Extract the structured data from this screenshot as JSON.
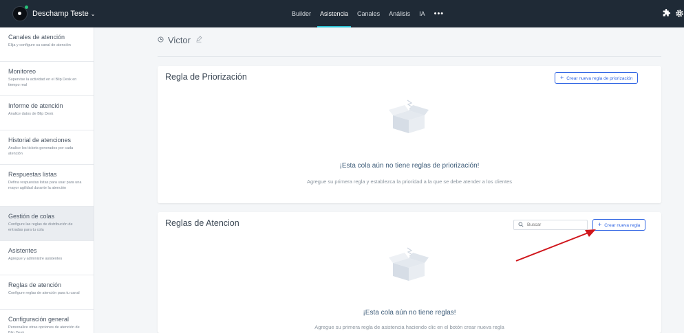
{
  "topbar": {
    "brand": "Deschamp Teste",
    "brand_chevron": "⌄",
    "nav": [
      "Builder",
      "Asistencia",
      "Canales",
      "Análisis",
      "IA"
    ],
    "active_nav": "Asistencia",
    "more": "•••",
    "icons": [
      "puzzle-icon",
      "gear-icon"
    ]
  },
  "sidebar": {
    "items": [
      {
        "title": "Canales de atención",
        "desc": "Elija y configure su canal de atención"
      },
      {
        "title": "Monitoreo",
        "desc": "Supervise la actividad en el Blip Desk en tiempo real"
      },
      {
        "title": "Informe de atención",
        "desc": "Analice datos de Blip Desk"
      },
      {
        "title": "Historial de atenciones",
        "desc": "Analice los tickets generados por cada atención"
      },
      {
        "title": "Respuestas listas",
        "desc": "Defina respuestas listas para usar para una mayor agilidad durante la atención"
      },
      {
        "title": "Gestión de colas",
        "desc": "Configure las reglas de distribución de entradas para tu cola"
      },
      {
        "title": "Asistentes",
        "desc": "Agregue y administre asistentes"
      },
      {
        "title": "Reglas de atención",
        "desc": "Configure reglas de atención para tu canal"
      },
      {
        "title": "Configuración general",
        "desc": "Personalice otras opciones de atención de Blip Desk"
      }
    ],
    "active_index": 5
  },
  "queue": {
    "name": "Victor"
  },
  "priority_card": {
    "title": "Regla de Priorización",
    "button_label": "Crear nueva regla de priorización",
    "empty_title": "¡Esta cola aún no tiene reglas de priorización!",
    "empty_desc": "Agregue su primera regla y establezca la prioridad a la que se debe atender a los clientes"
  },
  "rules_card": {
    "title": "Reglas de Atencion",
    "search_placeholder": "Buscar",
    "button_label": "Crear nueva regla",
    "empty_title": "¡Esta cola aún no tiene reglas!",
    "empty_desc": "Agregue su primera regla de asistencia haciendo clic en el botón crear nueva regla"
  },
  "colors": {
    "topbar": "#1f2a36",
    "accent": "#2f64e3",
    "nav_underline": "#2cc3d5",
    "annotation_arrow": "#d0161c"
  }
}
